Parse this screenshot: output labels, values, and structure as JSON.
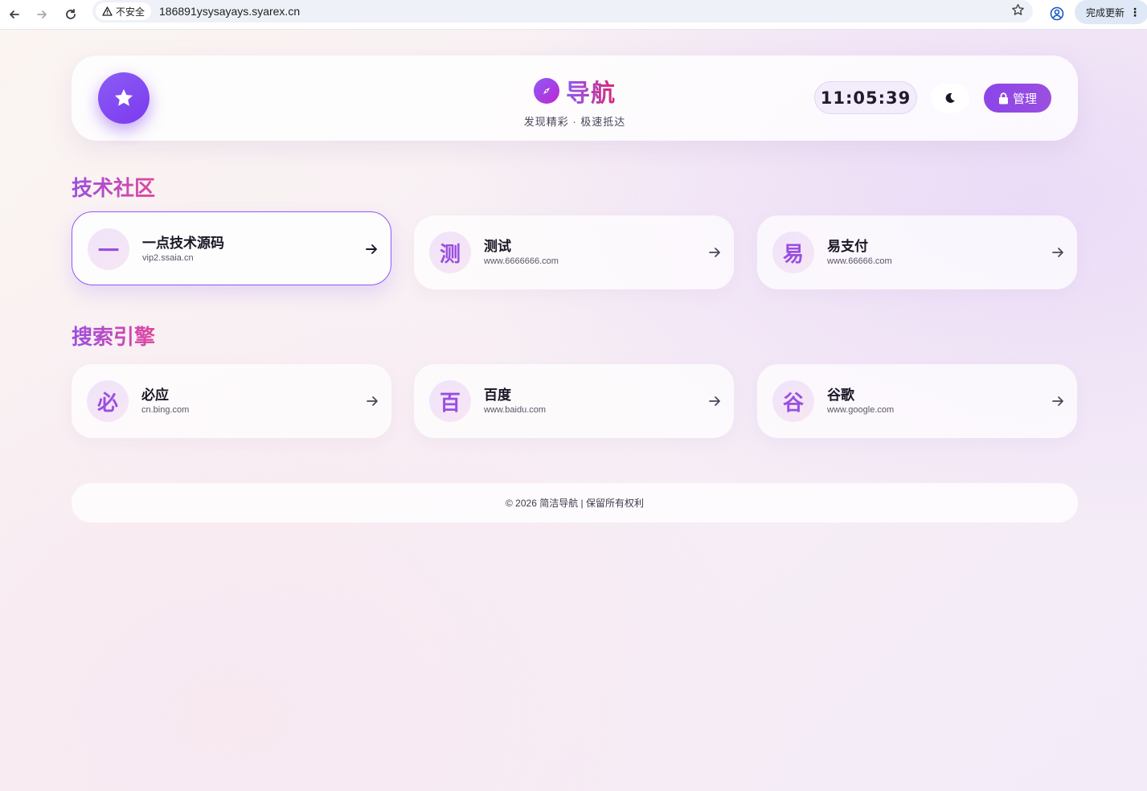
{
  "browser": {
    "security_label": "不安全",
    "url": "186891ysysayays.syarex.cn",
    "update_label": "完成更新"
  },
  "header": {
    "title": "导航",
    "subtitle": "发现精彩 · 极速抵达",
    "clock": "11:05:39",
    "admin_label": "管理"
  },
  "sections": [
    {
      "title": "技术社区",
      "links": [
        {
          "initial": "一",
          "name": "一点技术源码",
          "url": "vip2.ssaia.cn"
        },
        {
          "initial": "测",
          "name": "测试",
          "url": "www.6666666.com"
        },
        {
          "initial": "易",
          "name": "易支付",
          "url": "www.66666.com"
        }
      ]
    },
    {
      "title": "搜索引擎",
      "links": [
        {
          "initial": "必",
          "name": "必应",
          "url": "cn.bing.com"
        },
        {
          "initial": "百",
          "name": "百度",
          "url": "www.baidu.com"
        },
        {
          "initial": "谷",
          "name": "谷歌",
          "url": "www.google.com"
        }
      ]
    }
  ],
  "footer": {
    "text": "© 2026 简洁导航 | 保留所有权利"
  },
  "colors": {
    "accent": "#8b5cf6",
    "accent_pink": "#db2777"
  }
}
